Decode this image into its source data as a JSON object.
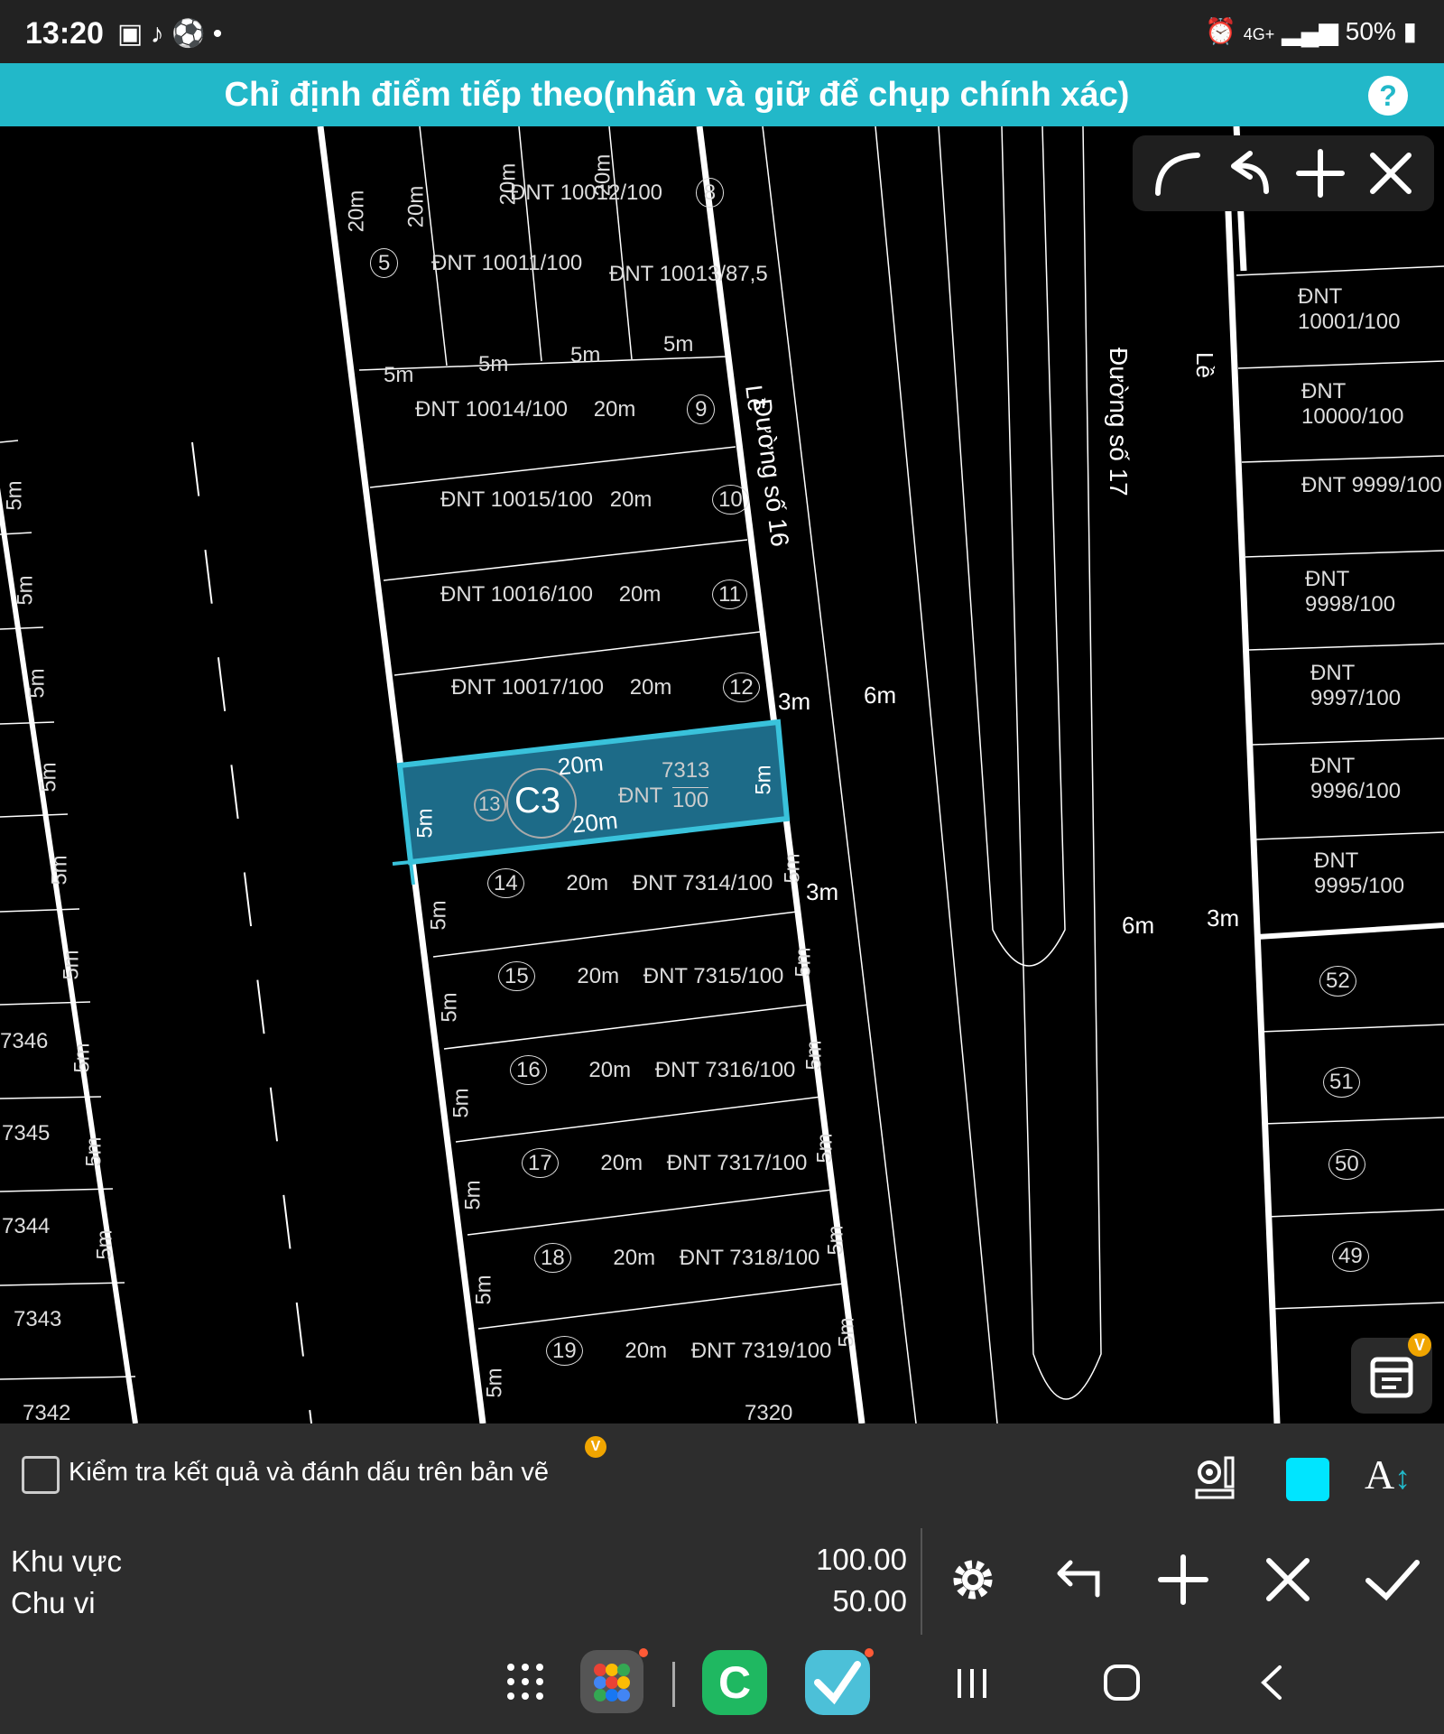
{
  "status_bar": {
    "time": "13:20",
    "network": "4G+",
    "battery": "50%"
  },
  "banner": {
    "title": "Chỉ định điểm tiếp theo(nhấn và giữ để chụp chính xác)",
    "help_label": "?"
  },
  "map": {
    "street_labels": [
      "Đường số 16",
      "Đường số 17"
    ],
    "curb_labels": [
      "Lề",
      "Lề"
    ],
    "road_widths": [
      "3m",
      "6m",
      "3m",
      "6m",
      "3m"
    ],
    "selected_lot": {
      "code": "C3",
      "number": "13",
      "land_code": "ĐNT",
      "parcel": "7313",
      "area": "100",
      "length": "20m",
      "width": "5m"
    },
    "lots_upper": [
      {
        "number": "9",
        "parcel": "10014",
        "area": "100",
        "length": "20m",
        "width": "5m"
      },
      {
        "number": "10",
        "parcel": "10015",
        "area": "100",
        "length": "20m",
        "width": "5m"
      },
      {
        "number": "11",
        "parcel": "10016",
        "area": "100",
        "length": "20m",
        "width": "5m"
      },
      {
        "number": "12",
        "parcel": "10017",
        "area": "100",
        "length": "20m",
        "width": "5m"
      }
    ],
    "lots_top": [
      {
        "number": "5",
        "parcel": "10011",
        "area": "100"
      },
      {
        "number": "8",
        "parcel": "10012",
        "area": "100"
      },
      {
        "number": "",
        "parcel": "10013",
        "area": "87,5"
      }
    ],
    "lots_lower": [
      {
        "number": "14",
        "parcel": "7314",
        "area": "100",
        "length": "20m",
        "width": "5m"
      },
      {
        "number": "15",
        "parcel": "7315",
        "area": "100",
        "length": "20m",
        "width": "5m"
      },
      {
        "number": "16",
        "parcel": "7316",
        "area": "100",
        "length": "20m",
        "width": "5m"
      },
      {
        "number": "17",
        "parcel": "7317",
        "area": "100",
        "length": "20m",
        "width": "5m"
      },
      {
        "number": "18",
        "parcel": "7318",
        "area": "100",
        "length": "20m",
        "width": "5m"
      },
      {
        "number": "19",
        "parcel": "7319",
        "area": "100",
        "length": "20m",
        "width": "5m"
      }
    ],
    "lots_right": [
      {
        "parcel": "10001",
        "area": "100"
      },
      {
        "parcel": "10000",
        "area": "100"
      },
      {
        "parcel": "9999",
        "area": "100"
      },
      {
        "parcel": "9998",
        "area": "100"
      },
      {
        "parcel": "9997",
        "area": "100"
      },
      {
        "parcel": "9996",
        "area": "100"
      },
      {
        "parcel": "9995",
        "area": "100"
      }
    ],
    "lots_right_lower": [
      "52",
      "51",
      "50",
      "49"
    ],
    "lots_left": [
      "7346",
      "7345",
      "7344",
      "7343",
      "7342"
    ],
    "land_code": "ĐNT",
    "width_label": "5m",
    "length_label": "20m",
    "length_label_short": "20m",
    "partial_bottom": "7320"
  },
  "toolbox": {
    "icons": [
      "arc-icon",
      "undo-icon",
      "add-icon",
      "close-icon"
    ]
  },
  "check_row": {
    "label": "Kiểm tra kết quả và đánh dấu trên bản vẽ",
    "badge": "V",
    "checked": false,
    "swatch_color": "#00e5ff"
  },
  "result": {
    "area_label": "Khu vực",
    "area_value": "100.00",
    "perimeter_label": "Chu vi",
    "perimeter_value": "50.00"
  },
  "colors": {
    "accent": "#22b8c9",
    "selection": "#1d6b88",
    "panel": "#2d2d2d"
  }
}
